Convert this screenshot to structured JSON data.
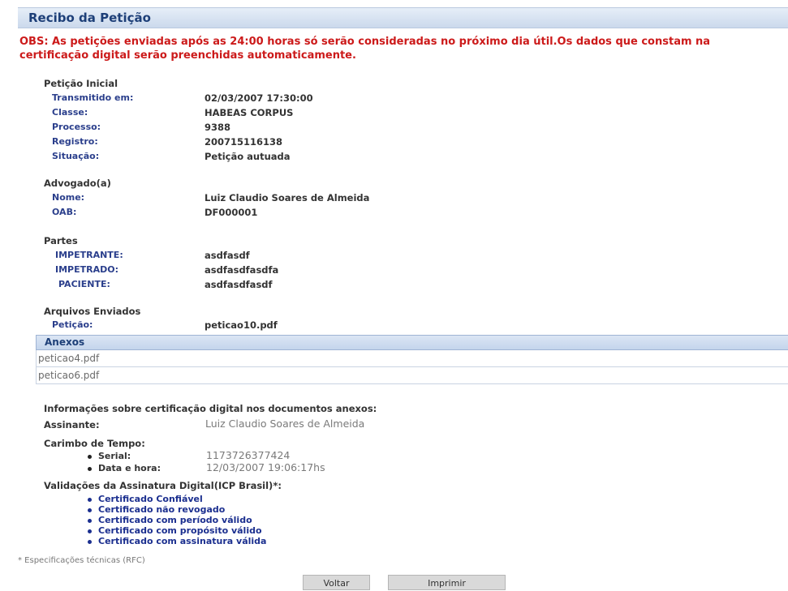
{
  "title": "Recibo da Petição",
  "obs": "OBS: As petições enviadas após as 24:00 horas só serão consideradas no próximo dia útil.Os dados que constam na certificação digital serão preenchidas automaticamente.",
  "peticao": {
    "heading": "Petição Inicial",
    "rows": [
      {
        "label": "Transmitido em:",
        "value": "02/03/2007 17:30:00"
      },
      {
        "label": "Classe:",
        "value": "HABEAS CORPUS"
      },
      {
        "label": "Processo:",
        "value": "9388"
      },
      {
        "label": "Registro:",
        "value": "200715116138"
      },
      {
        "label": "Situação:",
        "value": "Petição autuada"
      }
    ]
  },
  "advogado": {
    "heading": "Advogado(a)",
    "rows": [
      {
        "label": "Nome:",
        "value": "Luiz Claudio Soares de Almeida"
      },
      {
        "label": "OAB:",
        "value": "DF000001"
      }
    ]
  },
  "partes": {
    "heading": "Partes",
    "rows": [
      {
        "label": "IMPETRANTE:",
        "value": "asdfasdf"
      },
      {
        "label": "IMPETRADO:",
        "value": "asdfasdfasdfa"
      },
      {
        "label": "PACIENTE:",
        "value": "asdfasdfasdf"
      }
    ]
  },
  "arquivos": {
    "heading": "Arquivos Enviados",
    "label": "Petição:",
    "value": "peticao10.pdf"
  },
  "anexos": {
    "header": "Anexos",
    "files": [
      "peticao4.pdf",
      "peticao6.pdf"
    ]
  },
  "certificacao": {
    "info_heading": "Informações sobre certificação digital nos documentos anexos:",
    "assinante_label": "Assinante:",
    "assinante_value": "Luiz Claudio Soares de Almeida",
    "carimbo_heading": "Carimbo de Tempo:",
    "serial_label": "Serial:",
    "serial_value": "1173726377424",
    "data_label": "Data e hora:",
    "data_value": "12/03/2007 19:06:17hs",
    "validacoes_heading": "Validações da Assinatura Digital(ICP Brasil)*:",
    "validacoes": [
      "Certificado Confiável",
      "Certificado não revogado",
      "Certificado com período válido",
      "Certificado com propósito válido",
      "Certificado com assinatura válida"
    ]
  },
  "note": "* Especificações técnicas (RFC)",
  "buttons": {
    "voltar": "Voltar",
    "imprimir": "Imprimir"
  }
}
